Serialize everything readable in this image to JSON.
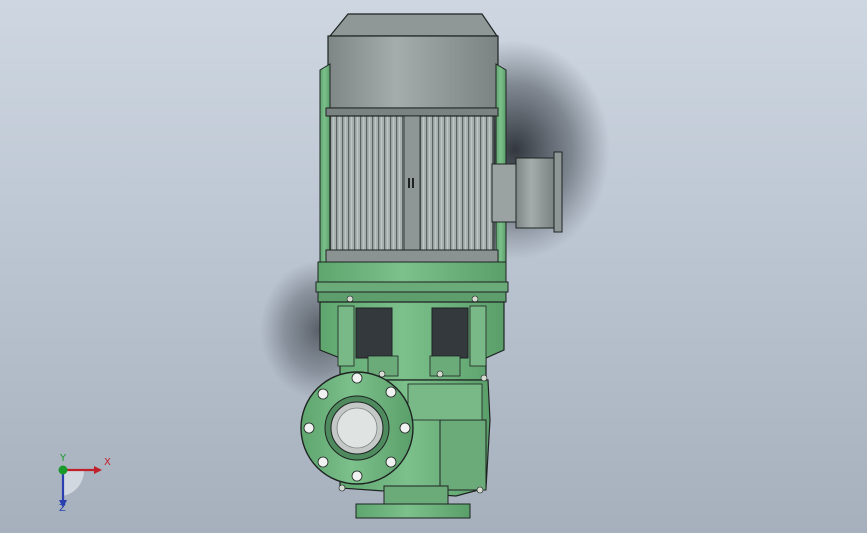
{
  "viewport": {
    "background_top": "#ced7e1",
    "background_bottom": "#a6b0bd"
  },
  "model": {
    "description_icon": "vertical-inline-pump-assembly",
    "motor_color": "#8e9795",
    "body_color": "#6fb27f"
  },
  "triad": {
    "x_label": "X",
    "y_label": "Y",
    "z_label": "Z",
    "x_color": "#c0202a",
    "y_color": "#1a9a2a",
    "z_color": "#2a40b0"
  }
}
